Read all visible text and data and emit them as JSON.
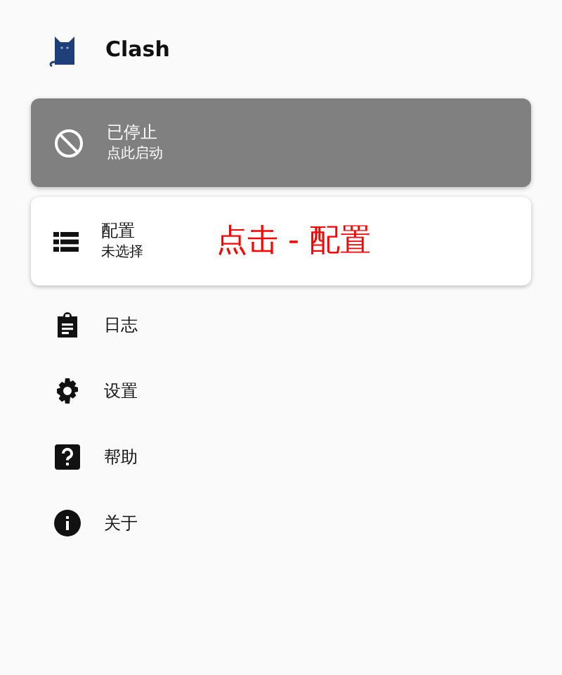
{
  "app": {
    "title": "Clash"
  },
  "status": {
    "title": "已停止",
    "subtitle": "点此启动",
    "running": false
  },
  "profile": {
    "title": "配置",
    "subtitle": "未选择",
    "annotation": "点击 - 配置"
  },
  "menu": [
    {
      "kind": "logs",
      "label": "日志"
    },
    {
      "kind": "settings",
      "label": "设置"
    },
    {
      "kind": "help",
      "label": "帮助"
    },
    {
      "kind": "about",
      "label": "关于"
    }
  ]
}
